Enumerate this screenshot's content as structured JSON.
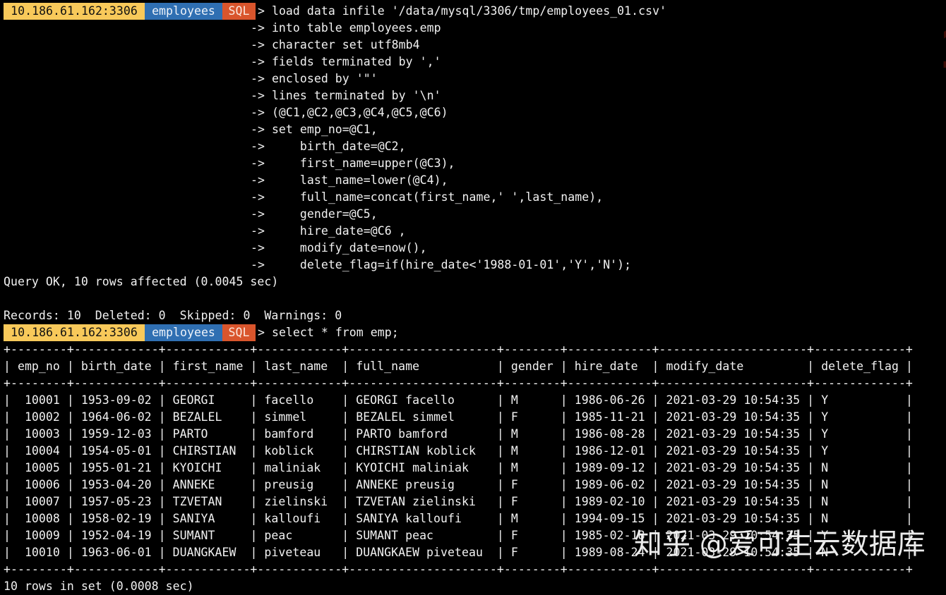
{
  "prompt": {
    "host": "10.186.61.162:3306",
    "database": "employees",
    "mode": "SQL",
    "arrow": ">",
    "continuation": "->"
  },
  "colors": {
    "background": "#000000",
    "text": "#f2f2f2",
    "prompt_host_bg": "#f8c95a",
    "prompt_db_bg": "#2f6fb2",
    "prompt_mode_bg": "#d9552c"
  },
  "command1": {
    "first_line": "load data infile '/data/mysql/3306/tmp/employees_01.csv'",
    "continuation_lines": [
      "into table employees.emp",
      "character set utf8mb4",
      "fields terminated by ','",
      "enclosed by '\"'",
      "lines terminated by '\\n'",
      "(@C1,@C2,@C3,@C4,@C5,@C6)",
      "set emp_no=@C1,",
      "    birth_date=@C2,",
      "    first_name=upper(@C3),",
      "    last_name=lower(@C4),",
      "    full_name=concat(first_name,' ',last_name),",
      "    gender=@C5,",
      "    hire_date=@C6 ,",
      "    modify_date=now(),",
      "    delete_flag=if(hire_date<'1988-01-01','Y','N');"
    ],
    "result": "Query OK, 10 rows affected (0.0045 sec)",
    "blank": "",
    "records": "Records: 10  Deleted: 0  Skipped: 0  Warnings: 0"
  },
  "command2": {
    "text": "select * from emp;"
  },
  "table": {
    "columns": [
      "emp_no",
      "birth_date",
      "first_name",
      "last_name",
      "full_name",
      "gender",
      "hire_date",
      "modify_date",
      "delete_flag"
    ],
    "widths": [
      6,
      10,
      10,
      10,
      19,
      6,
      10,
      19,
      11
    ],
    "align": [
      "right",
      "left",
      "left",
      "left",
      "left",
      "left",
      "left",
      "left",
      "left"
    ],
    "rows": [
      [
        "10001",
        "1953-09-02",
        "GEORGI",
        "facello",
        "GEORGI facello",
        "M",
        "1986-06-26",
        "2021-03-29 10:54:35",
        "Y"
      ],
      [
        "10002",
        "1964-06-02",
        "BEZALEL",
        "simmel",
        "BEZALEL simmel",
        "F",
        "1985-11-21",
        "2021-03-29 10:54:35",
        "Y"
      ],
      [
        "10003",
        "1959-12-03",
        "PARTO",
        "bamford",
        "PARTO bamford",
        "M",
        "1986-08-28",
        "2021-03-29 10:54:35",
        "Y"
      ],
      [
        "10004",
        "1954-05-01",
        "CHIRSTIAN",
        "koblick",
        "CHIRSTIAN koblick",
        "M",
        "1986-12-01",
        "2021-03-29 10:54:35",
        "Y"
      ],
      [
        "10005",
        "1955-01-21",
        "KYOICHI",
        "maliniak",
        "KYOICHI maliniak",
        "M",
        "1989-09-12",
        "2021-03-29 10:54:35",
        "N"
      ],
      [
        "10006",
        "1953-04-20",
        "ANNEKE",
        "preusig",
        "ANNEKE preusig",
        "F",
        "1989-06-02",
        "2021-03-29 10:54:35",
        "N"
      ],
      [
        "10007",
        "1957-05-23",
        "TZVETAN",
        "zielinski",
        "TZVETAN zielinski",
        "F",
        "1989-02-10",
        "2021-03-29 10:54:35",
        "N"
      ],
      [
        "10008",
        "1958-02-19",
        "SANIYA",
        "kalloufi",
        "SANIYA kalloufi",
        "M",
        "1994-09-15",
        "2021-03-29 10:54:35",
        "N"
      ],
      [
        "10009",
        "1952-04-19",
        "SUMANT",
        "peac",
        "SUMANT peac",
        "F",
        "1985-02-18",
        "2021-03-29 10:54:35",
        "Y"
      ],
      [
        "10010",
        "1963-06-01",
        "DUANGKAEW",
        "piveteau",
        "DUANGKAEW piveteau",
        "F",
        "1989-08-24",
        "2021-03-29 10:54:35",
        "N"
      ]
    ],
    "footer": "10 rows in set (0.0008 sec)"
  },
  "overlays": {
    "background_glyph": "1",
    "watermark": "知乎 @爱可生云数据库"
  }
}
